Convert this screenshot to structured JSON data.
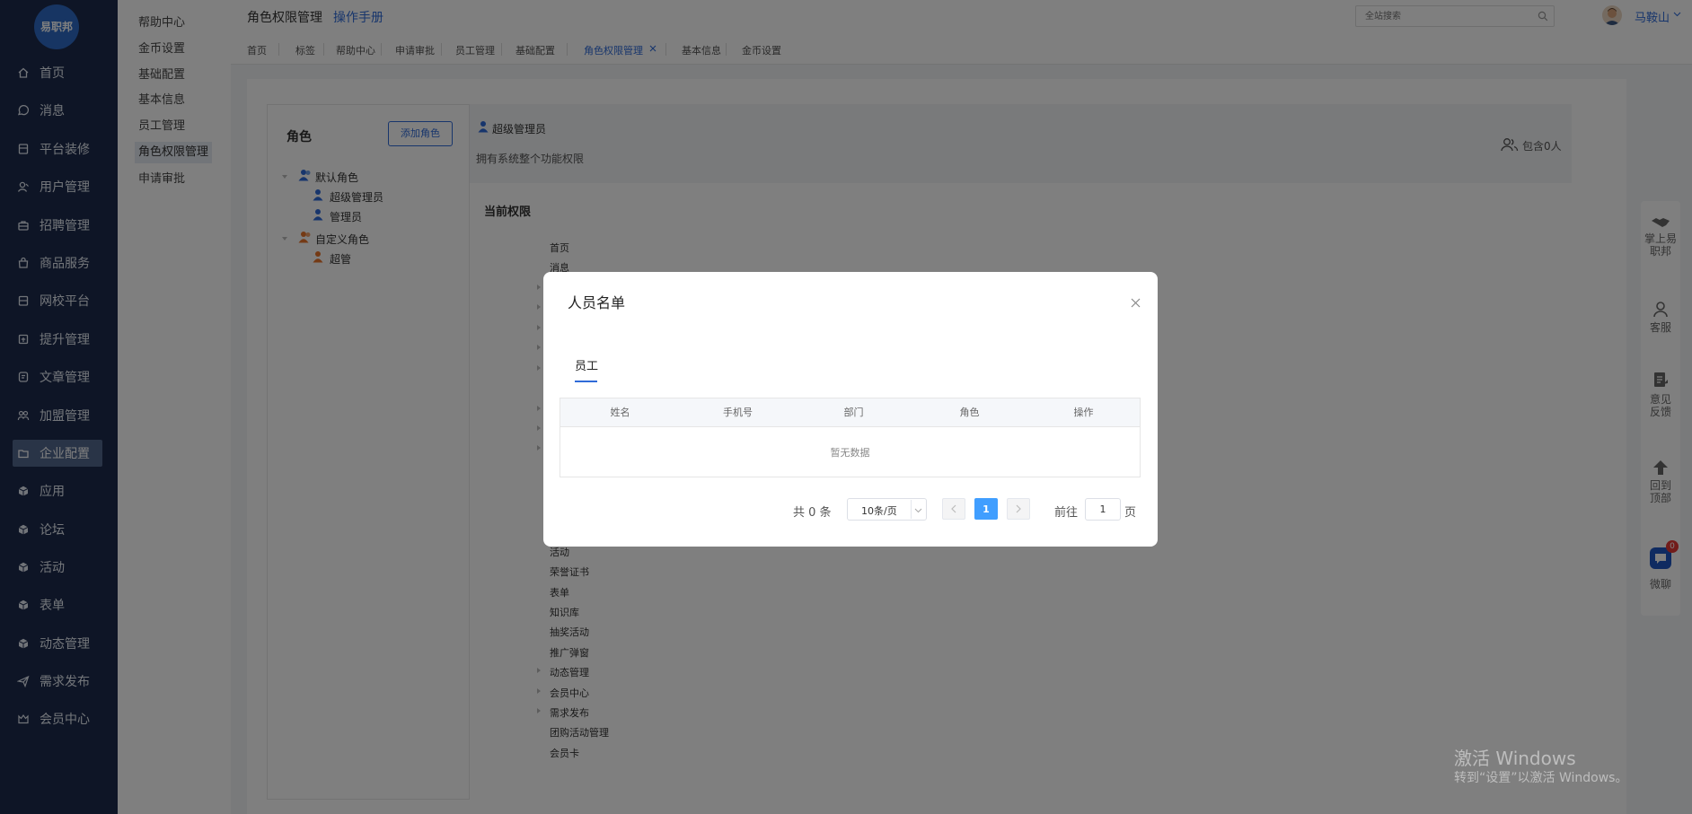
{
  "app": {
    "logo_text": "易职邦"
  },
  "nav": [
    {
      "label": "首页",
      "icon": "home-icon"
    },
    {
      "label": "消息",
      "icon": "message-icon"
    },
    {
      "label": "平台装修",
      "icon": "decoration-icon"
    },
    {
      "label": "用户管理",
      "icon": "user-icon"
    },
    {
      "label": "招聘管理",
      "icon": "briefcase-icon"
    },
    {
      "label": "商品服务",
      "icon": "shop-bag-icon"
    },
    {
      "label": "网校平台",
      "icon": "school-icon"
    },
    {
      "label": "提升管理",
      "icon": "upgrade-icon"
    },
    {
      "label": "文章管理",
      "icon": "article-icon"
    },
    {
      "label": "加盟管理",
      "icon": "franchise-icon"
    },
    {
      "label": "企业配置",
      "icon": "folder-icon"
    },
    {
      "label": "应用",
      "icon": "cube-icon"
    },
    {
      "label": "论坛",
      "icon": "cube-icon"
    },
    {
      "label": "活动",
      "icon": "cube-icon"
    },
    {
      "label": "表单",
      "icon": "cube-icon"
    },
    {
      "label": "动态管理",
      "icon": "cube-icon"
    },
    {
      "label": "需求发布",
      "icon": "send-icon"
    },
    {
      "label": "会员中心",
      "icon": "vip-icon"
    }
  ],
  "subnav": [
    "帮助中心",
    "金币设置",
    "基础配置",
    "基本信息",
    "员工管理",
    "角色权限管理",
    "申请审批"
  ],
  "header": {
    "title": "角色权限管理",
    "manual_link": "操作手册",
    "search_placeholder": "全站搜索",
    "user_name": "马鞍山"
  },
  "tabs": [
    "首页",
    "标签",
    "帮助中心",
    "申请审批",
    "员工管理",
    "基础配置",
    "角色权限管理",
    "基本信息",
    "金币设置"
  ],
  "roles": {
    "title": "角色",
    "add_button": "添加角色",
    "groups": [
      {
        "label": "默认角色",
        "children": [
          "超级管理员",
          "管理员"
        ]
      },
      {
        "label": "自定义角色",
        "children": [
          "超管"
        ]
      }
    ]
  },
  "role_detail": {
    "name": "超级管理员",
    "description": "拥有系统整个功能权限",
    "member_count": "包含0人",
    "current_permissions_title": "当前权限"
  },
  "permissions_visible": [
    {
      "label": "首页",
      "expandable": false
    },
    {
      "label": "消息",
      "expandable": false
    },
    {
      "label": "活动",
      "expandable": false
    },
    {
      "label": "荣誉证书",
      "expandable": false
    },
    {
      "label": "表单",
      "expandable": false
    },
    {
      "label": "知识库",
      "expandable": false
    },
    {
      "label": "抽奖活动",
      "expandable": false
    },
    {
      "label": "推广弹窗",
      "expandable": false
    },
    {
      "label": "动态管理",
      "expandable": true
    },
    {
      "label": "会员中心",
      "expandable": true
    },
    {
      "label": "需求发布",
      "expandable": true
    },
    {
      "label": "团购活动管理",
      "expandable": false
    },
    {
      "label": "会员卡",
      "expandable": false
    }
  ],
  "right_toolbar": [
    {
      "label": "掌上易职邦",
      "icon": "handshake-icon"
    },
    {
      "label": "客服",
      "icon": "customer-service-icon"
    },
    {
      "label": "意见反馈",
      "icon": "feedback-icon"
    },
    {
      "label": "回到顶部",
      "icon": "arrow-up-icon"
    },
    {
      "label": "微聊",
      "icon": "chat-icon",
      "badge": "0"
    }
  ],
  "watermark": {
    "line1": "激活 Windows",
    "line2": "转到“设置”以激活 Windows。"
  },
  "modal": {
    "title": "人员名单",
    "tab": "员工",
    "columns": [
      "姓名",
      "手机号",
      "部门",
      "角色",
      "操作"
    ],
    "empty_text": "暂无数据",
    "pagination": {
      "total_text": "共 0 条",
      "page_size": "10条/页",
      "current_page": "1",
      "goto_prefix": "前往",
      "goto_value": "1",
      "goto_suffix": "页"
    }
  },
  "colors": {
    "sidebar": "#1d2b4c",
    "primary": "#409eff",
    "link": "#2f6bd8"
  }
}
